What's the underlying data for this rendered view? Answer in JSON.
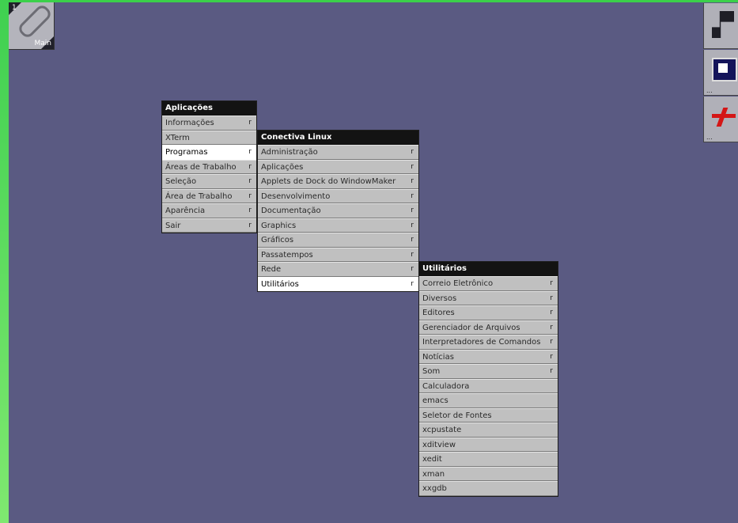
{
  "desktop": {
    "background": "#5a5a82",
    "frame_color": "#3bd04a"
  },
  "clip": {
    "workspace_number": "1",
    "workspace_name": "Main",
    "icon": "paperclip-icon"
  },
  "dock": [
    {
      "icon": "terminal-app-icon",
      "label": ""
    },
    {
      "icon": "monitor-app-icon",
      "label": "..."
    },
    {
      "icon": "red-logo-app-icon",
      "label": "..."
    }
  ],
  "menus": {
    "aplicacoes": {
      "title": "Aplicações",
      "items": [
        {
          "label": "Informações",
          "submenu": true,
          "selected": false
        },
        {
          "label": "XTerm",
          "submenu": false,
          "selected": false
        },
        {
          "label": "Programas",
          "submenu": true,
          "selected": true
        },
        {
          "label": "Áreas de Trabalho",
          "submenu": true,
          "selected": false
        },
        {
          "label": "Seleção",
          "submenu": true,
          "selected": false
        },
        {
          "label": "Área de Trabalho",
          "submenu": true,
          "selected": false
        },
        {
          "label": "Aparência",
          "submenu": true,
          "selected": false
        },
        {
          "label": "Sair",
          "submenu": true,
          "selected": false
        }
      ]
    },
    "conectiva": {
      "title": "Conectiva Linux",
      "items": [
        {
          "label": "Administração",
          "submenu": true,
          "selected": false
        },
        {
          "label": "Aplicações",
          "submenu": true,
          "selected": false
        },
        {
          "label": "Applets de Dock do WindowMaker",
          "submenu": true,
          "selected": false
        },
        {
          "label": "Desenvolvimento",
          "submenu": true,
          "selected": false
        },
        {
          "label": "Documentação",
          "submenu": true,
          "selected": false
        },
        {
          "label": "Graphics",
          "submenu": true,
          "selected": false
        },
        {
          "label": "Gráficos",
          "submenu": true,
          "selected": false
        },
        {
          "label": "Passatempos",
          "submenu": true,
          "selected": false
        },
        {
          "label": "Rede",
          "submenu": true,
          "selected": false
        },
        {
          "label": "Utilitários",
          "submenu": true,
          "selected": true
        }
      ]
    },
    "utilitarios": {
      "title": "Utilitários",
      "items": [
        {
          "label": "Correio Eletrônico",
          "submenu": true,
          "selected": false
        },
        {
          "label": "Diversos",
          "submenu": true,
          "selected": false
        },
        {
          "label": "Editores",
          "submenu": true,
          "selected": false
        },
        {
          "label": "Gerenciador de Arquivos",
          "submenu": true,
          "selected": false
        },
        {
          "label": "Interpretadores de Comandos",
          "submenu": true,
          "selected": false
        },
        {
          "label": "Notícias",
          "submenu": true,
          "selected": false
        },
        {
          "label": "Som",
          "submenu": true,
          "selected": false
        },
        {
          "label": "Calculadora",
          "submenu": false,
          "selected": false
        },
        {
          "label": "emacs",
          "submenu": false,
          "selected": false
        },
        {
          "label": "Seletor de Fontes",
          "submenu": false,
          "selected": false
        },
        {
          "label": "xcpustate",
          "submenu": false,
          "selected": false
        },
        {
          "label": "xditview",
          "submenu": false,
          "selected": false
        },
        {
          "label": "xedit",
          "submenu": false,
          "selected": false
        },
        {
          "label": "xman",
          "submenu": false,
          "selected": false
        },
        {
          "label": "xxgdb",
          "submenu": false,
          "selected": false
        }
      ],
      "submenu_glyph": "r"
    }
  }
}
